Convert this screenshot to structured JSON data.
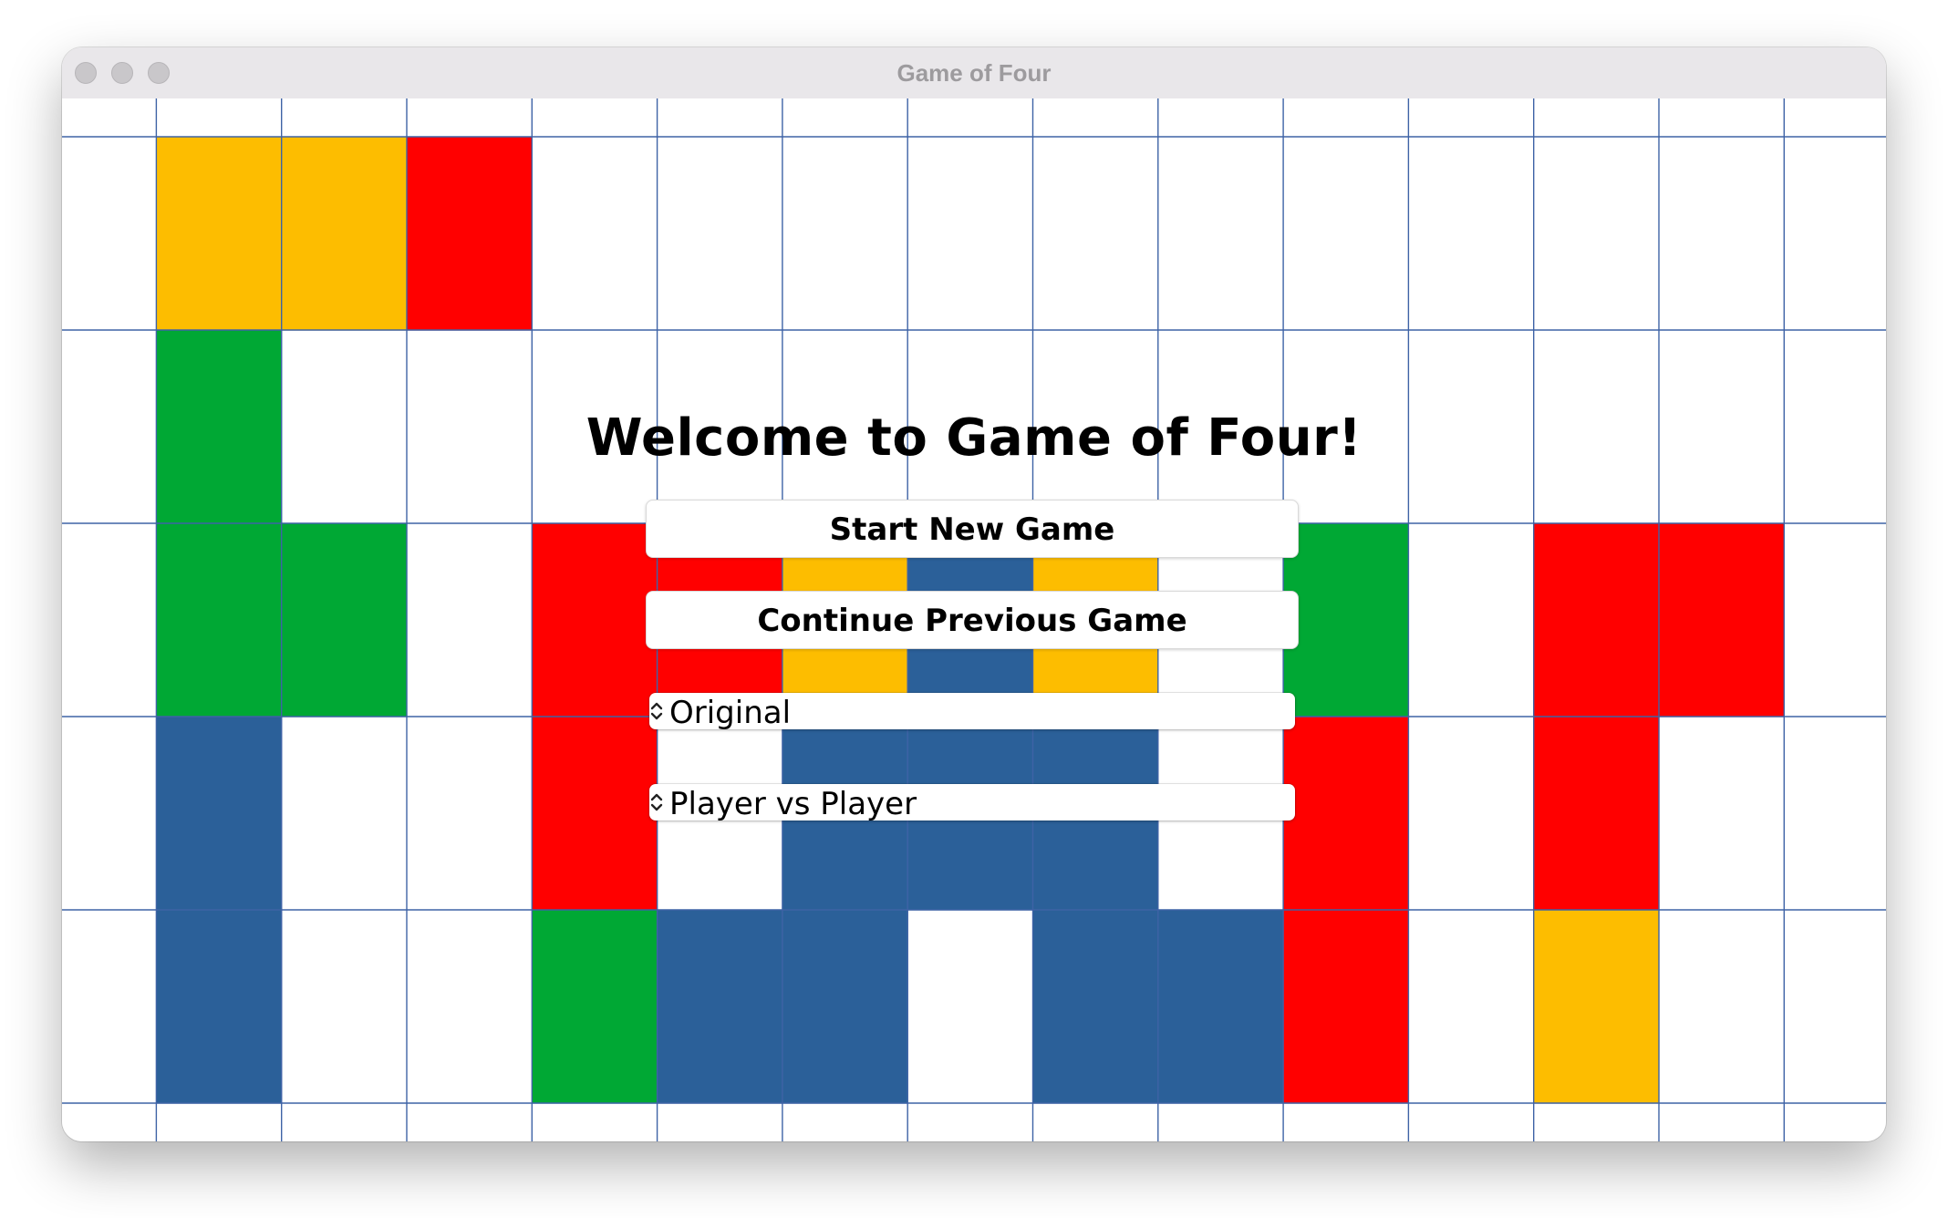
{
  "window": {
    "title": "Game of Four"
  },
  "menu": {
    "title": "Welcome to Game of Four!",
    "start_label": "Start New Game",
    "continue_label": "Continue Previous Game",
    "mode_select": {
      "selected": "Original"
    },
    "players_select": {
      "selected": "Player vs Player"
    }
  },
  "board": {
    "colors": {
      "Y": "#FDBD00",
      "R": "#FF0000",
      "G": "#00A834",
      "B": "#2B6099",
      "grid": "#3E63A6"
    },
    "rows": [
      ".YYR...........",
      ".G.............",
      ".GG.RRYBY.G.RR.",
      ".B..R.BBB.R.R..",
      ".B..GBB.BBR.Y.."
    ]
  }
}
